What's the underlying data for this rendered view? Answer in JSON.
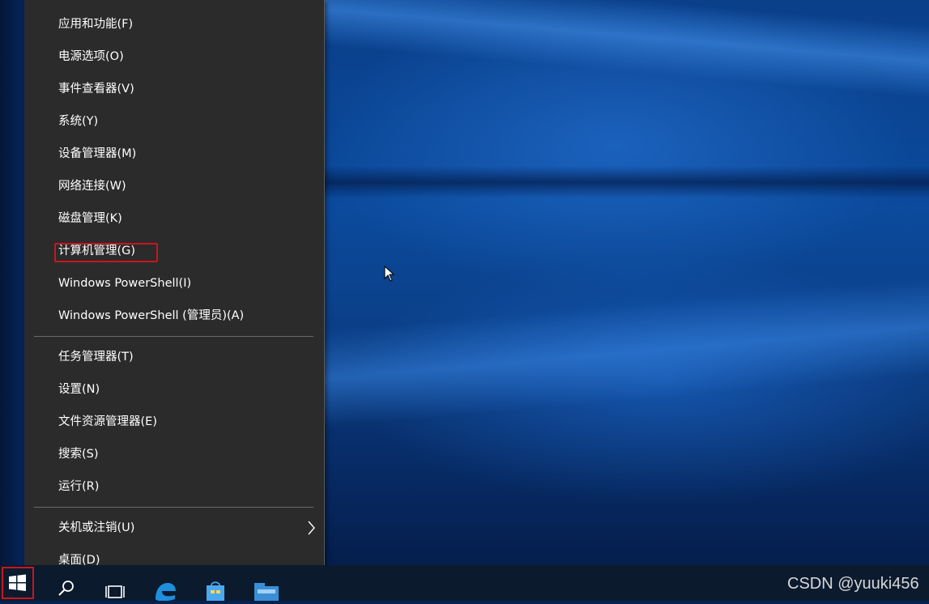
{
  "menu": {
    "group1": [
      {
        "label": "应用和功能(F)"
      },
      {
        "label": "电源选项(O)"
      },
      {
        "label": "事件查看器(V)"
      },
      {
        "label": "系统(Y)"
      },
      {
        "label": "设备管理器(M)"
      },
      {
        "label": "网络连接(W)"
      },
      {
        "label": "磁盘管理(K)"
      },
      {
        "label": "计算机管理(G)",
        "highlighted": true
      },
      {
        "label": "Windows PowerShell(I)"
      },
      {
        "label": "Windows PowerShell (管理员)(A)"
      }
    ],
    "group2": [
      {
        "label": "任务管理器(T)"
      },
      {
        "label": "设置(N)"
      },
      {
        "label": "文件资源管理器(E)"
      },
      {
        "label": "搜索(S)"
      },
      {
        "label": "运行(R)"
      }
    ],
    "group3": [
      {
        "label": "关机或注销(U)",
        "has_submenu": true
      },
      {
        "label": "桌面(D)"
      }
    ]
  },
  "taskbar": {
    "icons": [
      "start-icon",
      "search-icon",
      "task-view-icon",
      "edge-icon",
      "store-icon",
      "file-explorer-icon"
    ]
  },
  "watermark": "CSDN @yuuki456",
  "colors": {
    "menu_bg": "#2b2b2b",
    "menu_text": "#ffffff",
    "highlight_border": "#c8161e",
    "taskbar_bg": "#0c1a2e",
    "desktop_blue": "#0b4a9c"
  }
}
